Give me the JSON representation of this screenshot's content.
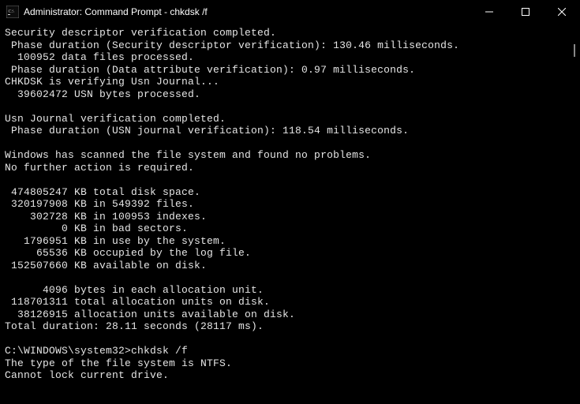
{
  "titlebar": {
    "icon_name": "cmd-icon",
    "title": "Administrator: Command Prompt - chkdsk  /f"
  },
  "window_controls": {
    "minimize": "minimize",
    "maximize": "maximize",
    "close": "close"
  },
  "terminal": {
    "lines": [
      "Security descriptor verification completed.",
      " Phase duration (Security descriptor verification): 130.46 milliseconds.",
      "  100952 data files processed.",
      " Phase duration (Data attribute verification): 0.97 milliseconds.",
      "CHKDSK is verifying Usn Journal...",
      "  39602472 USN bytes processed.",
      "",
      "Usn Journal verification completed.",
      " Phase duration (USN journal verification): 118.54 milliseconds.",
      "",
      "Windows has scanned the file system and found no problems.",
      "No further action is required.",
      "",
      " 474805247 KB total disk space.",
      " 320197908 KB in 549392 files.",
      "    302728 KB in 100953 indexes.",
      "         0 KB in bad sectors.",
      "   1796951 KB in use by the system.",
      "     65536 KB occupied by the log file.",
      " 152507660 KB available on disk.",
      "",
      "      4096 bytes in each allocation unit.",
      " 118701311 total allocation units on disk.",
      "  38126915 allocation units available on disk.",
      "Total duration: 28.11 seconds (28117 ms).",
      "",
      "C:\\WINDOWS\\system32>chkdsk /f",
      "The type of the file system is NTFS.",
      "Cannot lock current drive."
    ]
  }
}
